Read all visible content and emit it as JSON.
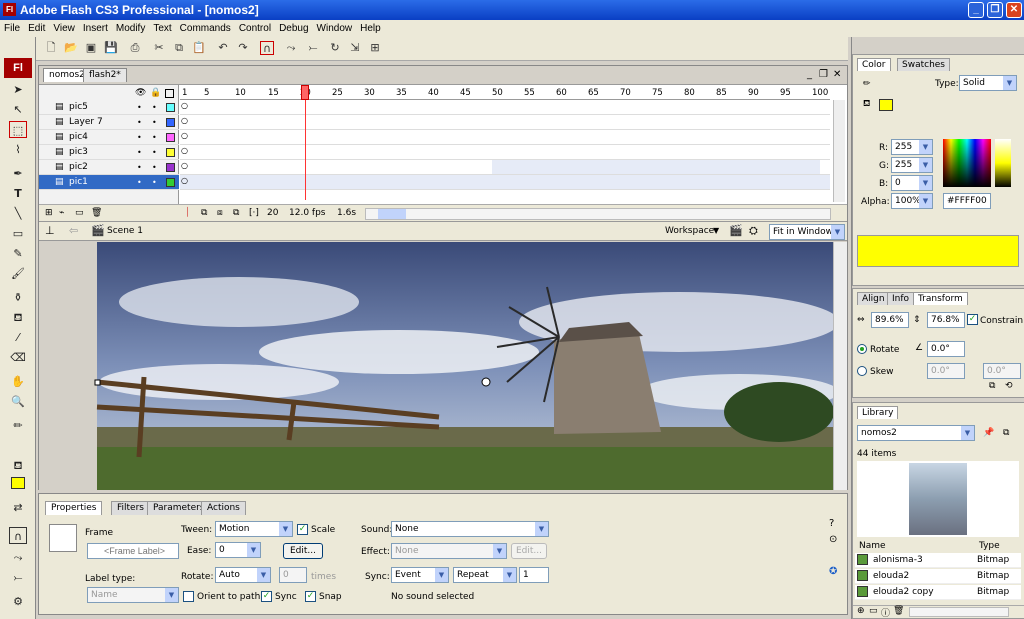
{
  "window": {
    "title": "Adobe Flash CS3 Professional - [nomos2]",
    "app_badge": "Fl"
  },
  "menu": [
    "File",
    "Edit",
    "View",
    "Insert",
    "Modify",
    "Text",
    "Commands",
    "Control",
    "Debug",
    "Window",
    "Help"
  ],
  "doc_tabs": [
    "nomos2",
    "flash2*"
  ],
  "timeline": {
    "ruler": [
      "1",
      "5",
      "10",
      "15",
      "20",
      "25",
      "30",
      "35",
      "40",
      "45",
      "50",
      "55",
      "60",
      "65",
      "70",
      "75",
      "80",
      "85",
      "90",
      "95",
      "100"
    ],
    "layers": [
      {
        "name": "pic5",
        "color": "#66ffff"
      },
      {
        "name": "Layer 7",
        "color": "#3366ff"
      },
      {
        "name": "pic4",
        "color": "#ff66ff"
      },
      {
        "name": "pic3",
        "color": "#ffff33"
      },
      {
        "name": "pic2",
        "color": "#9933cc"
      },
      {
        "name": "pic1",
        "color": "#33cc33",
        "selected": true
      }
    ],
    "current_frame": "20",
    "fps": "12.0 fps",
    "time": "1.6s"
  },
  "scene_bar": {
    "scene": "Scene 1",
    "workspace": "Workspace",
    "zoom": "Fit in Window"
  },
  "properties": {
    "tabs": [
      "Properties",
      "Filters",
      "Parameters",
      "Actions"
    ],
    "frame_label": "Frame",
    "frame_label_placeholder": "<Frame Label>",
    "label_type_label": "Label type:",
    "label_type_value": "Name",
    "tween_label": "Tween:",
    "tween_value": "Motion",
    "scale_label": "Scale",
    "ease_label": "Ease:",
    "ease_value": "0",
    "edit_button": "Edit...",
    "rotate_label": "Rotate:",
    "rotate_value": "Auto",
    "times_value": "0",
    "times_label": "times",
    "orient_label": "Orient to path",
    "sync_label": "Sync",
    "snap_label": "Snap",
    "sound_label": "Sound:",
    "sound_value": "None",
    "effect_label": "Effect:",
    "effect_value": "None",
    "sync_sound_label": "Sync:",
    "sync_event": "Event",
    "sync_repeat": "Repeat",
    "repeat_count": "1",
    "no_sound": "No sound selected"
  },
  "color_panel": {
    "tabs": [
      "Color",
      "Swatches"
    ],
    "type_label": "Type:",
    "type_value": "Solid",
    "r_label": "R:",
    "r": "255",
    "g_label": "G:",
    "g": "255",
    "b_label": "B:",
    "b": "0",
    "alpha_label": "Alpha:",
    "alpha": "100%",
    "hex": "#FFFF00",
    "fill": "#FFFF00"
  },
  "transform_panel": {
    "tabs": [
      "Align",
      "Info",
      "Transform"
    ],
    "width": "89.6%",
    "height": "76.8%",
    "constrain": "Constrain",
    "rotate_label": "Rotate",
    "rotate_value": "0.0°",
    "skew_label": "Skew",
    "skew_h": "0.0°",
    "skew_v": "0.0°"
  },
  "library_panel": {
    "tab": "Library",
    "doc": "nomos2",
    "count": "44 items",
    "col_name": "Name",
    "col_type": "Type",
    "items": [
      {
        "name": "alonisma-3",
        "type": "Bitmap"
      },
      {
        "name": "elouda2",
        "type": "Bitmap"
      },
      {
        "name": "elouda2 copy",
        "type": "Bitmap"
      }
    ]
  }
}
